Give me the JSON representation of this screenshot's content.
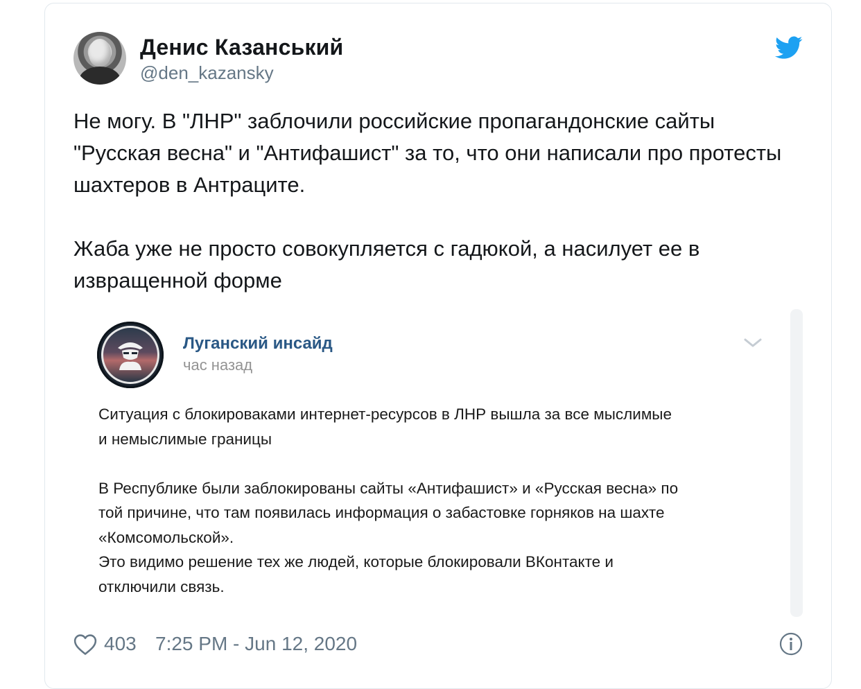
{
  "author": {
    "name": "Денис Казанський",
    "handle": "@den_kazansky"
  },
  "tweet": {
    "paragraphs": [
      "Не могу. В \"ЛНР\" заблочили российские пропагандонские сайты \"Русская весна\" и \"Антифашист\" за то, что они написали про протесты шахтеров в Антраците.",
      "Жаба уже не просто совокупляется с гадюкой, а насилует ее в извращенной форме"
    ]
  },
  "embedded_post": {
    "channel_name": "Луганский инсайд",
    "time": "час назад",
    "lines": [
      "Ситуация с блокироваками интернет-ресурсов в ЛНР вышла за все мыслимые",
      "и немыслимые границы",
      "В Республике были заблокированы сайты «Антифашист» и «Русская весна» по",
      "той причине, что там появилась информация о забастовке горняков на шахте",
      "«Комсомольской».",
      "Это видимо решение тех же людей, которые блокировали ВКонтакте и",
      "отключили связь."
    ]
  },
  "footer": {
    "likes": "403",
    "timestamp": "7:25 PM - Jun 12, 2020"
  },
  "icons": {
    "twitter": "twitter-bird-icon",
    "chevron": "chevron-down-icon",
    "heart": "heart-icon",
    "info": "info-icon"
  },
  "colors": {
    "twitter_blue": "#1da1f2",
    "vk_link": "#2a5885",
    "muted": "#657786"
  }
}
